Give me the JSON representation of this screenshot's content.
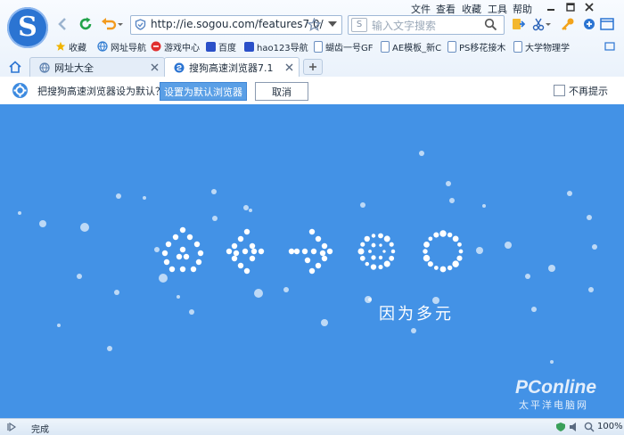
{
  "toolbar": {
    "url": "http://ie.sogou.com/features7.0/",
    "search_placeholder": "输入文字搜索"
  },
  "menu": [
    "文件",
    "查看",
    "收藏",
    "工具",
    "帮助"
  ],
  "bookmarks": [
    {
      "label": "收藏",
      "icon": "star-icon",
      "color": "#f0b400"
    },
    {
      "label": "网址导航",
      "icon": "globe-icon",
      "color": "#2f7bd1"
    },
    {
      "label": "游戏中心",
      "icon": "game-icon",
      "color": "#e03030"
    },
    {
      "label": "百度",
      "icon": "paw-icon",
      "color": "#2b50c8"
    },
    {
      "label": "hao123导航",
      "icon": "paw-icon",
      "color": "#2b50c8"
    },
    {
      "label": "蝴齿一号GF",
      "icon": "page-icon",
      "color": "#6b8fc0"
    },
    {
      "label": "AE模板_新C",
      "icon": "page-icon",
      "color": "#6b8fc0"
    },
    {
      "label": "PS移花接木",
      "icon": "page-icon",
      "color": "#6b8fc0"
    },
    {
      "label": "大学物理学",
      "icon": "page-icon",
      "color": "#6b8fc0"
    }
  ],
  "tabs": [
    {
      "label": "网址大全"
    },
    {
      "label": "搜狗高速浏览器7.1"
    }
  ],
  "notification": {
    "message": "把搜狗高速浏览器设为默认？",
    "set_default": "设置为默认浏览器",
    "cancel": "取消",
    "dont_show": "不再提示"
  },
  "page": {
    "slogan": "因为多元",
    "watermark": "PConline",
    "watermark_sub": "太平洋电脑网"
  },
  "status": {
    "text": "完成",
    "zoom": "100%"
  },
  "colors": {
    "content_bg": "#4392e6",
    "set_default_bg": "#5a9fe6"
  }
}
